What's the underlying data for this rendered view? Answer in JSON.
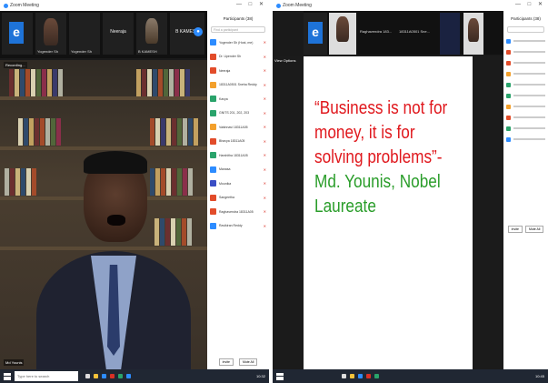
{
  "left": {
    "window_title": "Zoom Meeting",
    "strip": {
      "tiles": [
        {
          "label": "",
          "type": "logo"
        },
        {
          "label": "Yogender Sh",
          "type": "face"
        },
        {
          "label": "Yogender Sh",
          "type": "text"
        },
        {
          "label": "Neeraja",
          "type": "text"
        },
        {
          "label": "B KAMESH",
          "type": "face"
        },
        {
          "label": "B KAMESH",
          "type": "text"
        }
      ]
    },
    "recording": "Recording...",
    "video_label": "Md Younis",
    "panel": {
      "title": "Participants (38)",
      "search_placeholder": "Find a participant",
      "participants": [
        {
          "name": "Yogender Sh (Host, me)",
          "color": "#2d8cff"
        },
        {
          "name": "Dr. Upender Sh",
          "color": "#e24c2a"
        },
        {
          "name": "Neeraja",
          "color": "#e24c2a"
        },
        {
          "name": "18311A0501 Sneha Reddy",
          "color": "#f3a02c"
        },
        {
          "name": "Kavya",
          "color": "#2aa36b"
        },
        {
          "name": "GNITS 201, 202, 203",
          "color": "#2aa36b"
        },
        {
          "name": "Vaishnavi 18311A05",
          "color": "#f3a02c"
        },
        {
          "name": "Bhavya 18311A05",
          "color": "#e24c2a"
        },
        {
          "name": "Harshitha 18311A05",
          "color": "#2aa36b"
        },
        {
          "name": "Manasa",
          "color": "#2d8cff"
        },
        {
          "name": "Mounika",
          "color": "#3a4ec5"
        },
        {
          "name": "Sangeetha",
          "color": "#e24c2a"
        },
        {
          "name": "Raghavendra 18311A05",
          "color": "#e24c2a"
        },
        {
          "name": "Ravikiran Reddy",
          "color": "#2d8cff"
        }
      ],
      "footer": [
        "Invite",
        "Mute All"
      ]
    },
    "taskbar": {
      "search": "Type here to search",
      "tray": "10:32"
    }
  },
  "right": {
    "window_title": "Zoom Meeting",
    "strip": {
      "tiles": [
        {
          "label": "",
          "type": "logo"
        },
        {
          "label": "Raghavendra 183...",
          "type": "face"
        },
        {
          "label": "18311A0501 Sne...",
          "type": "text"
        },
        {
          "label": "",
          "type": "face"
        }
      ]
    },
    "view_option": "View Options",
    "slide": {
      "quote_red": "“Business is not for money, it is for solving problems”-",
      "quote_green": "Md. Younis, Nobel Laureate"
    },
    "panel": {
      "title": "Participants (38)",
      "footer": [
        "Invite",
        "Mute All"
      ]
    },
    "taskbar": {
      "tray": "10:45"
    }
  }
}
